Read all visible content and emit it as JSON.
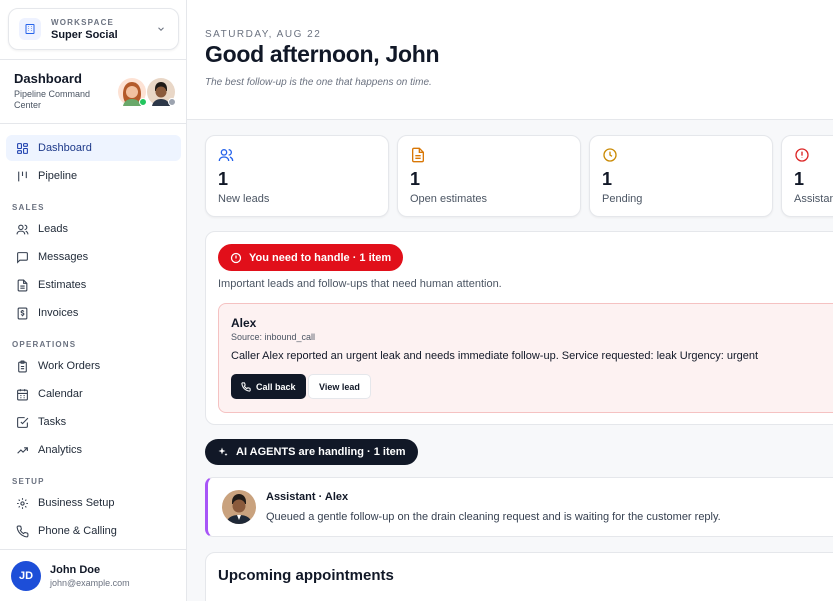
{
  "workspace": {
    "label": "WORKSPACE",
    "name": "Super Social"
  },
  "sidebar_header": {
    "title": "Dashboard",
    "subtitle": "Pipeline Command Center"
  },
  "nav": {
    "dashboard": "Dashboard",
    "pipeline": "Pipeline",
    "sales_label": "SALES",
    "leads": "Leads",
    "messages": "Messages",
    "estimates": "Estimates",
    "invoices": "Invoices",
    "operations_label": "OPERATIONS",
    "work_orders": "Work Orders",
    "calendar": "Calendar",
    "tasks": "Tasks",
    "analytics": "Analytics",
    "setup_label": "SETUP",
    "business_setup": "Business Setup",
    "phone_calling": "Phone & Calling"
  },
  "user": {
    "initials": "JD",
    "name": "John Doe",
    "email": "john@example.com"
  },
  "header": {
    "date": "SATURDAY, AUG 22",
    "greeting": "Good afternoon, John",
    "tagline": "The best follow-up is the one that happens on time."
  },
  "stats": [
    {
      "value": "1",
      "label": "New leads",
      "icon": "users-icon",
      "color": "#2563eb"
    },
    {
      "value": "1",
      "label": "Open estimates",
      "icon": "document-icon",
      "color": "#d97706"
    },
    {
      "value": "1",
      "label": "Pending",
      "icon": "clock-icon",
      "color": "#ca8a04"
    },
    {
      "value": "1",
      "label": "Assistant",
      "icon": "alert-icon",
      "color": "#dc2626"
    }
  ],
  "attention": {
    "badge": "You need to handle · 1 item",
    "description": "Important leads and follow-ups that need human attention.",
    "lead": {
      "name": "Alex",
      "source": "Source: inbound_call",
      "message": "Caller Alex reported an urgent leak and needs immediate follow-up. Service requested: leak Urgency: urgent",
      "call_label": "Call back",
      "view_label": "View lead"
    }
  },
  "agents": {
    "badge": "AI AGENTS are handling · 1 item",
    "item": {
      "title": "Assistant · Alex",
      "message": "Queued a gentle follow-up on the drain cleaning request and is waiting for the customer reply."
    }
  },
  "appointments": {
    "title": "Upcoming appointments"
  },
  "colors": {
    "accent": "#1d4ed8",
    "danger": "#e10f1a",
    "agent_border": "#a855f7"
  }
}
